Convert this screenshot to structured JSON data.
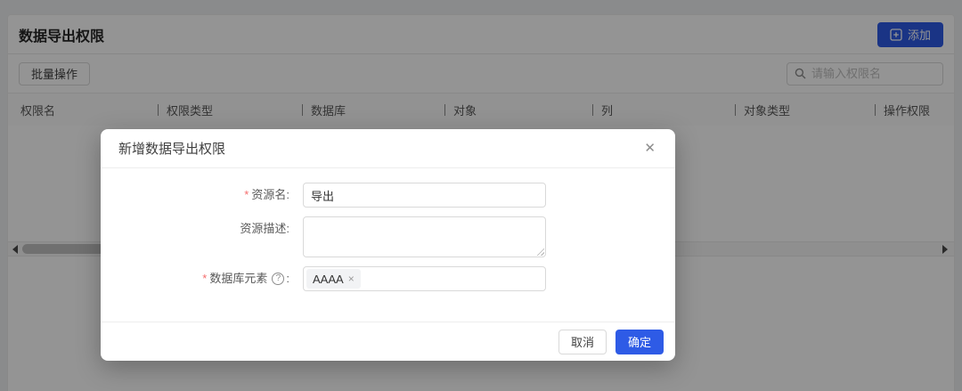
{
  "colors": {
    "primary": "#2e5be6",
    "required": "#f56c6c"
  },
  "icons": {
    "close": "✕",
    "tag_remove": "×",
    "help": "?"
  },
  "page": {
    "title": "数据导出权限",
    "add_button_label": "添加",
    "batch_button_label": "批量操作",
    "search_placeholder": "请输入权限名",
    "table_columns": [
      "权限名",
      "权限类型",
      "数据库",
      "对象",
      "列",
      "对象类型",
      "操作权限"
    ],
    "table_rows": []
  },
  "modal": {
    "title": "新增数据导出权限",
    "required_mark": "*",
    "label_colon": ":",
    "fields": {
      "resource_name": {
        "label": "资源名",
        "value": "导出"
      },
      "resource_desc": {
        "label": "资源描述",
        "value": ""
      },
      "db_elements": {
        "label": "数据库元素",
        "tag": "AAAA"
      }
    },
    "cancel_label": "取消",
    "confirm_label": "确定"
  }
}
